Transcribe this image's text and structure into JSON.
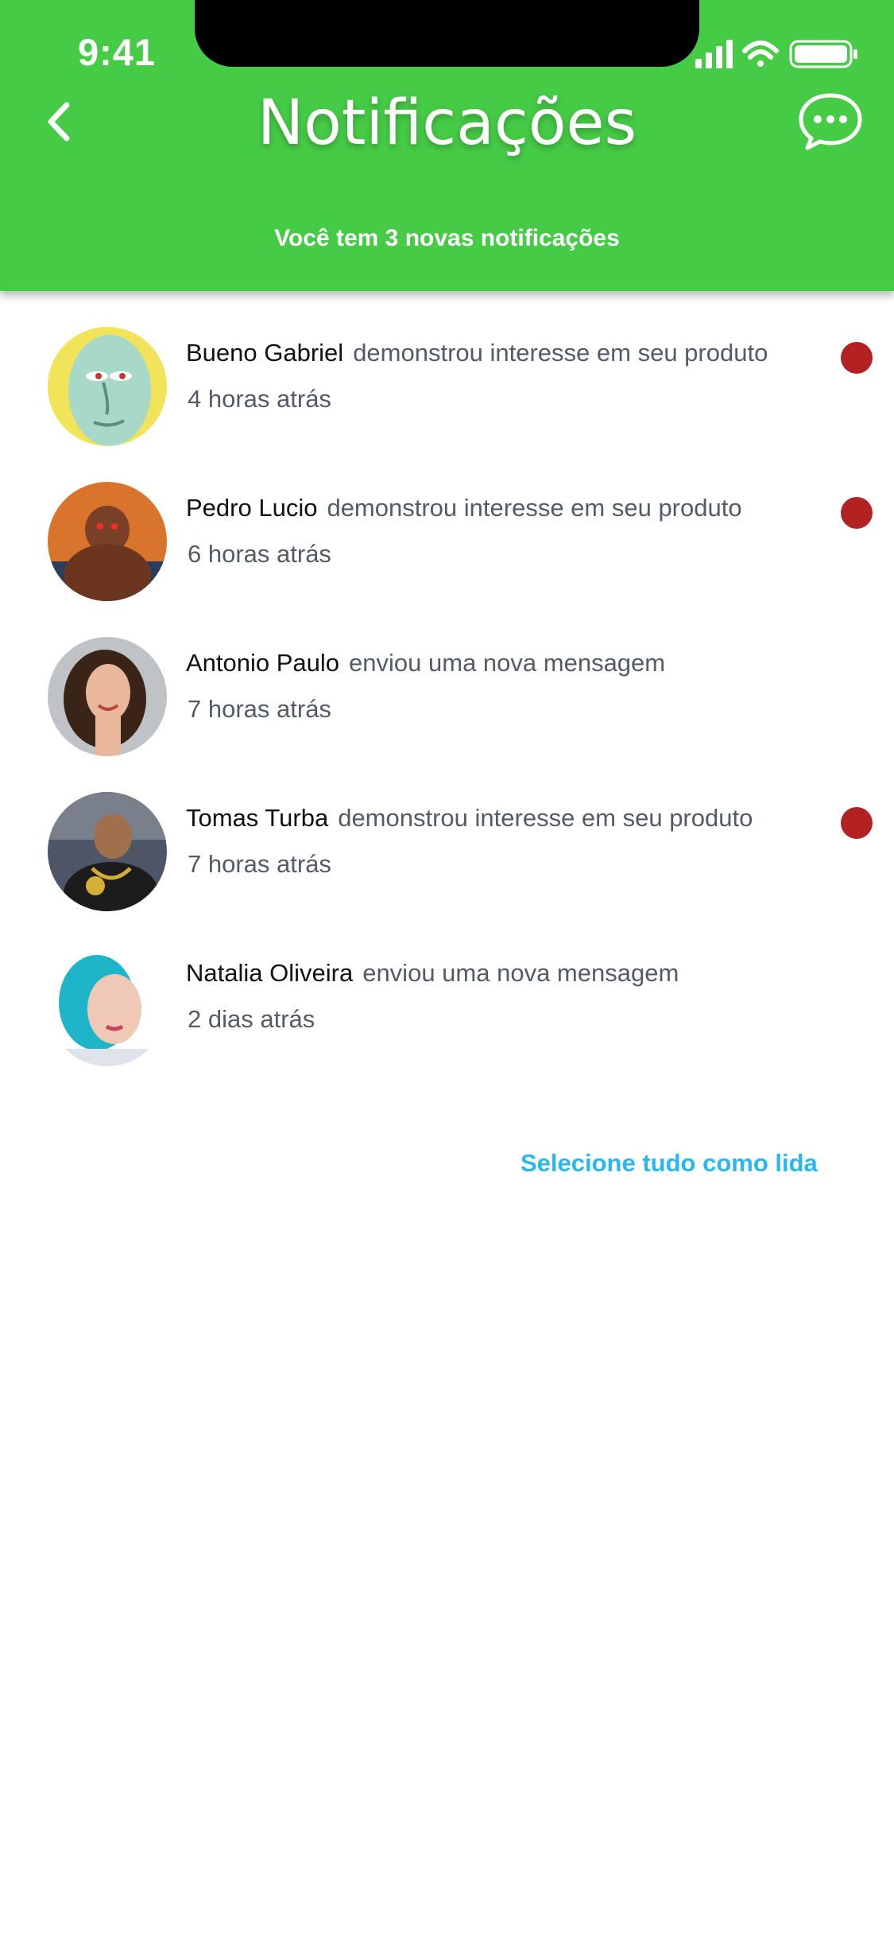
{
  "status_bar": {
    "time": "9:41"
  },
  "header": {
    "title": "Notificações",
    "subtitle": "Você tem 3 novas notificações",
    "back_icon": "chevron-left-icon",
    "chat_icon": "chat-bubble-icon",
    "background_color": "#46cb46"
  },
  "notifications": [
    {
      "name": "Bueno Gabriel",
      "action": "demonstrou interesse em seu produto",
      "time": "4 horas atrás",
      "unread": true
    },
    {
      "name": "Pedro Lucio",
      "action": "demonstrou interesse em seu produto",
      "time": "6 horas atrás",
      "unread": true
    },
    {
      "name": "Antonio Paulo",
      "action": "enviou uma nova mensagem",
      "time": "7 horas atrás",
      "unread": false
    },
    {
      "name": "Tomas Turba",
      "action": "demonstrou interesse em seu produto",
      "time": "7 horas atrás",
      "unread": true
    },
    {
      "name": "Natalia Oliveira",
      "action": "enviou uma nova mensagem",
      "time": "2 dias atrás",
      "unread": false
    }
  ],
  "footer": {
    "mark_all_label": "Selecione tudo como lida",
    "link_color": "#2ab7f0"
  },
  "colors": {
    "unread_dot": "#b22222"
  }
}
